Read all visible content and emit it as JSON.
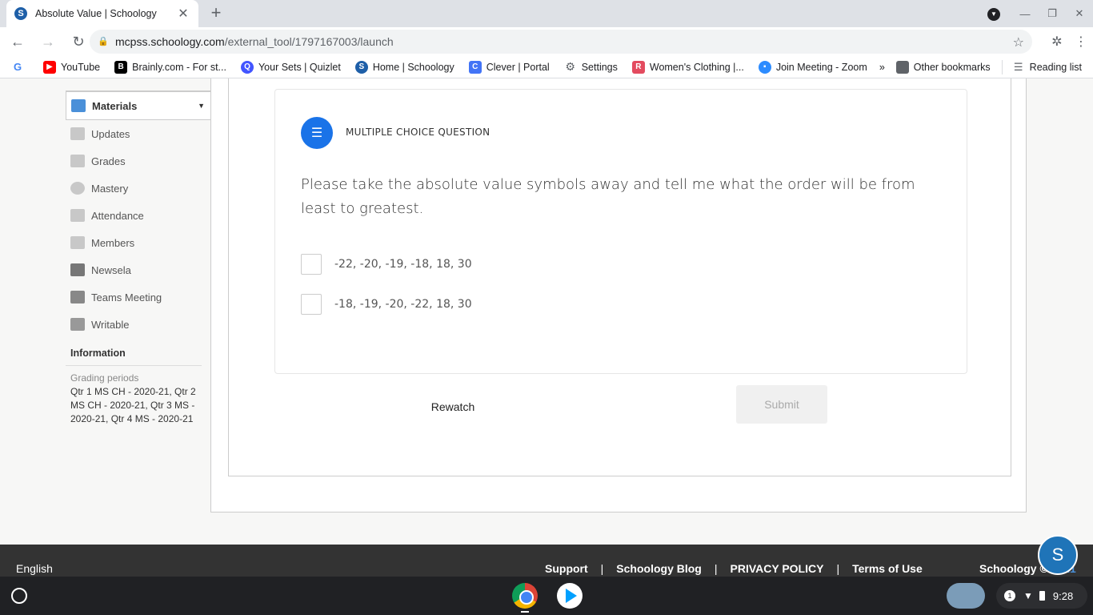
{
  "browser": {
    "tab_title": "Absolute Value | Schoology",
    "tab_favicon": "S",
    "url_host": "mcpss.schoology.com",
    "url_path": "/external_tool/1797167003/launch"
  },
  "bookmarks": [
    {
      "label": "",
      "icon": "google-icon",
      "color": "#4285f4"
    },
    {
      "label": "YouTube",
      "icon": "youtube-icon",
      "color": "#ff0000"
    },
    {
      "label": "Brainly.com - For st...",
      "icon": "brainly-icon",
      "color": "#000000"
    },
    {
      "label": "Your Sets | Quizlet",
      "icon": "quizlet-icon",
      "color": "#4255ff"
    },
    {
      "label": "Home | Schoology",
      "icon": "schoology-icon",
      "color": "#1e5fa8"
    },
    {
      "label": "Clever | Portal",
      "icon": "clever-icon",
      "color": "#4274f6"
    },
    {
      "label": "Settings",
      "icon": "gear-icon",
      "color": "#5f6368"
    },
    {
      "label": "Women's Clothing |...",
      "icon": "clothing-icon",
      "color": "#e34b5f"
    },
    {
      "label": "Join Meeting - Zoom",
      "icon": "zoom-icon",
      "color": "#2d8cff"
    }
  ],
  "bookmarks_right": {
    "other": "Other bookmarks",
    "reading": "Reading list"
  },
  "sidebar": {
    "items": [
      {
        "label": "Materials",
        "icon": "materials-icon",
        "active": true
      },
      {
        "label": "Updates",
        "icon": "updates-icon"
      },
      {
        "label": "Grades",
        "icon": "grades-icon"
      },
      {
        "label": "Mastery",
        "icon": "mastery-icon"
      },
      {
        "label": "Attendance",
        "icon": "attendance-icon"
      },
      {
        "label": "Members",
        "icon": "members-icon"
      },
      {
        "label": "Newsela",
        "icon": "newsela-icon"
      },
      {
        "label": "Teams Meeting",
        "icon": "teams-icon"
      },
      {
        "label": "Writable",
        "icon": "writable-icon"
      }
    ],
    "info_heading": "Information",
    "grading_label": "Grading periods",
    "grading_text": "Qtr 1 MS CH - 2020-21, Qtr 2 MS CH - 2020-21, Qtr 3 MS - 2020-21, Qtr 4 MS - 2020-21"
  },
  "question": {
    "type_label": "MULTIPLE CHOICE QUESTION",
    "text": "Please take the absolute value symbols away and tell me what the order will be from least to greatest.",
    "options": [
      "-22, -20, -19, -18, 18, 30",
      "-18, -19, -20, -22, 18, 30"
    ],
    "rewatch_label": "Rewatch",
    "submit_label": "Submit"
  },
  "footer": {
    "language": "English",
    "links": [
      "Support",
      "Schoology Blog",
      "PRIVACY POLICY",
      "Terms of Use"
    ],
    "copyright": "Schoology © ",
    "year": "2021",
    "chat_initial": "S"
  },
  "shelf": {
    "notification_count": "1",
    "time": "9:28"
  },
  "colors": {
    "accent": "#1a73e8",
    "footer_bg": "#333333"
  }
}
